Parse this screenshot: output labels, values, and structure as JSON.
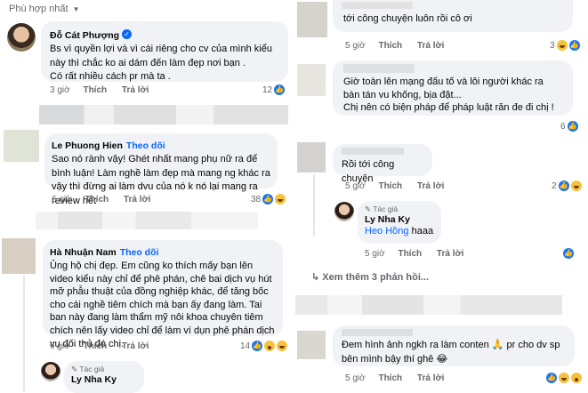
{
  "filter_label": "Phù hợp nhất",
  "action_like": "Thích",
  "action_reply": "Trả lời",
  "author_tag": "Tác giả",
  "colors": {
    "link": "#0866ff",
    "bubble": "#f0f2f5",
    "meta": "#65676b",
    "like": "#1877f2"
  },
  "left": {
    "c1": {
      "name": "Đỗ Cát Phượng",
      "text": "Bs vì quyền lợi và vì cái riêng cho cv của mình kiểu này thì chắc ko ai dám đến làm đẹp nơi bạn .\nCó rất nhiều cách pr mà ta .",
      "time": "3 giờ",
      "count": "12"
    },
    "c2": {
      "name": "Le Phuong Hien",
      "follow": "Theo dõi",
      "text": "Sao nó rành vậy! Ghét nhất mang phụ nữ ra để bình luận! Làm nghề làm đẹp mà mang ng khác ra vậy thì đừng ai làm dvu của nó k nó lại mang ra review hết",
      "time": "6 giờ",
      "count": "38"
    },
    "c3": {
      "name": "Hà Nhuận Nam",
      "follow": "Theo dõi",
      "text": "Ủng hộ chị đẹp.  Em cũng ko thích mấy bạn lên video kiểu này chỉ để phê phán, chê bai dịch vụ hút mỡ phẫu thuật của đồng nghiệp khác, để tăng bốc cho cái nghề tiêm chích mà bạn ấy đang làm. Tai ban này đang làm thẩm mỹ nôi khoa chuyên tiêm chích nên lấy video chỉ để làm ví dụn phê phán dịch vụ đối thủ đó chị.",
      "time": "6 giờ",
      "count": "14"
    },
    "c4": {
      "name": "Ly Nha Ky"
    }
  },
  "right": {
    "r1": {
      "text": "tới công chuyện luôn rồi cô ơi",
      "time": "5 giờ",
      "count": "3"
    },
    "r2": {
      "text": "Giờ toàn lên mạng đấu tố và lôi người khác ra bàn tán vu khống, bịa đặt...\nChị nên có biện pháp để pháp luật răn đe đi chị !",
      "time": "5 giờ",
      "count": "6"
    },
    "r3": {
      "text": "Rồi tới công chuyện",
      "time": "5 giờ",
      "count": "2"
    },
    "r4": {
      "name": "Ly Nha Ky",
      "tag": "Heo Hồng",
      "text": " haaa",
      "time": "5 giờ"
    },
    "more": "Xem thêm 3 phản hồi...",
    "r5": {
      "text": "Đem hình ảnh ngkh ra làm conten 🙏 pr cho dv sp bên mình bậy thí ghê 😂",
      "time": "5 giờ"
    }
  }
}
